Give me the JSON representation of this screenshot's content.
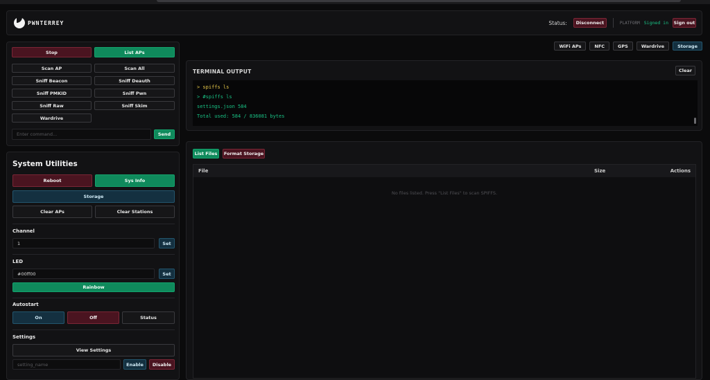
{
  "app": {
    "logo_text": "PWNTERREY"
  },
  "header": {
    "status_label": "Status:",
    "disconnect": "Disconnect",
    "platform": "PLATFORM",
    "signed_in": "Signed in",
    "sign_out": "Sign out"
  },
  "attack": {
    "stop": "Stop",
    "list_aps": "List APs",
    "buttons": [
      "Scan AP",
      "Scan All",
      "Sniff Beacon",
      "Sniff Deauth",
      "Sniff PMKID",
      "Sniff Pwn",
      "Sniff Raw",
      "Sniff Skim",
      "Wardrive"
    ],
    "command_placeholder": "Enter command...",
    "send": "Send"
  },
  "system": {
    "title": "System Utilities",
    "reboot": "Reboot",
    "sys_info": "Sys Info",
    "storage": "Storage",
    "clear_aps": "Clear APs",
    "clear_stations": "Clear Stations",
    "channel_label": "Channel",
    "channel_value": "1",
    "set": "Set",
    "led_label": "LED",
    "led_value": "#00ff00",
    "rainbow": "Rainbow",
    "autostart_label": "Autostart",
    "on": "On",
    "off": "Off",
    "status": "Status",
    "settings_label": "Settings",
    "view_settings": "View Settings",
    "setting_placeholder": "setting_name",
    "enable": "Enable",
    "disable": "Disable"
  },
  "tabs": [
    "WiFi APs",
    "NFC",
    "GPS",
    "Wardrive",
    "Storage"
  ],
  "terminal": {
    "title": "TERMINAL OUTPUT",
    "clear": "Clear",
    "lines": [
      {
        "text": "> spiffs ls",
        "color": "#e8c94a"
      },
      {
        "text": "> #spiffs ls",
        "color": "#19c285"
      },
      {
        "text": "settings.json 584",
        "color": "#19c285"
      },
      {
        "text": "Total used: 584 / 836081 bytes",
        "color": "#19c285"
      }
    ]
  },
  "files": {
    "list_files": "List Files",
    "format_storage": "Format Storage",
    "columns": {
      "file": "File",
      "size": "Size",
      "actions": "Actions"
    },
    "empty_message": "No files listed. Press \"List Files\" to scan SPIFFS."
  }
}
